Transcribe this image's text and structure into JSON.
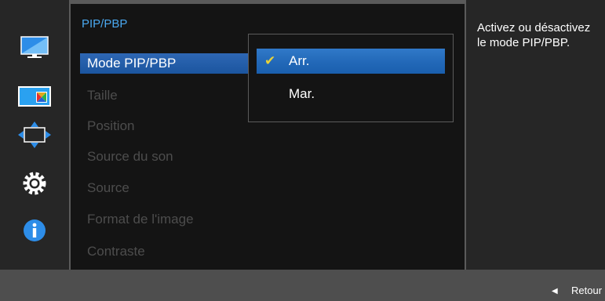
{
  "sidebar": {
    "items": [
      {
        "icon": "monitor-icon",
        "selected": false
      },
      {
        "icon": "color-picture-icon",
        "selected": true
      },
      {
        "icon": "position-arrows-icon",
        "selected": false
      },
      {
        "icon": "gear-icon",
        "selected": false
      },
      {
        "icon": "info-icon",
        "selected": false
      }
    ]
  },
  "menu": {
    "title": "PIP/PBP",
    "items": [
      {
        "label": "Mode PIP/PBP",
        "active": true
      },
      {
        "label": "Taille"
      },
      {
        "label": "Position"
      },
      {
        "label": "Source du son"
      },
      {
        "label": "Source"
      },
      {
        "label": "Format de l'image"
      },
      {
        "label": "Contraste"
      }
    ]
  },
  "popup": {
    "options": [
      {
        "label": "Arr.",
        "selected": true,
        "icon": "check-icon"
      },
      {
        "label": "Mar.",
        "selected": false
      }
    ]
  },
  "help": {
    "text": "Activez ou désactivez le mode PIP/PBP."
  },
  "footer": {
    "back_label": "Retour",
    "back_icon": "left-triangle-icon"
  },
  "colors": {
    "accent": "#4aa8ef",
    "highlight": "#2468b6",
    "checkmark": "#e8d23a",
    "disabled_text": "#4d4d4d"
  }
}
